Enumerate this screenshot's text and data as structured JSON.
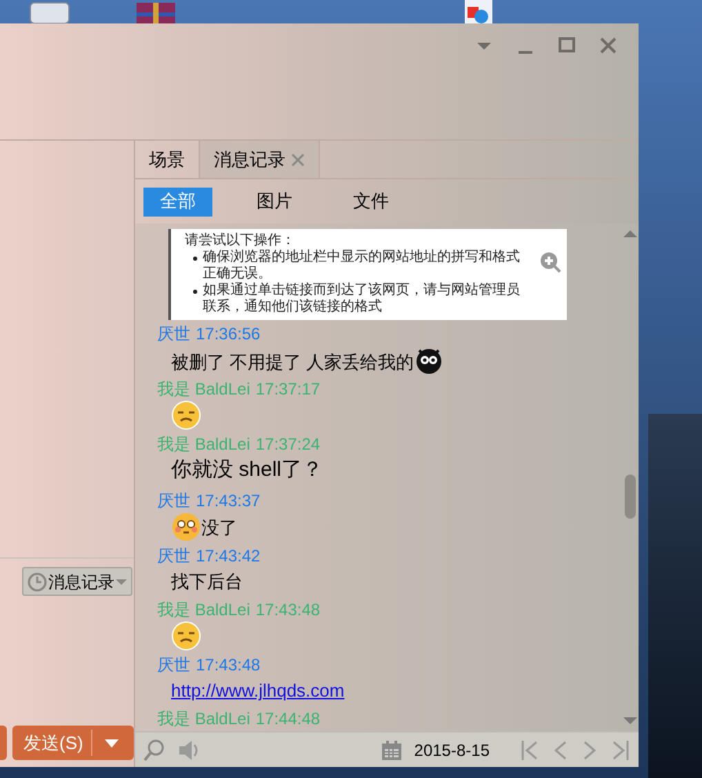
{
  "tabs": [
    {
      "label": "场景",
      "selected": false,
      "closable": false
    },
    {
      "label": "消息记录",
      "selected": true,
      "closable": true
    }
  ],
  "filters": [
    {
      "label": "全部",
      "selected": true
    },
    {
      "label": "图片",
      "selected": false
    },
    {
      "label": "文件",
      "selected": false
    }
  ],
  "messages": [
    {
      "body": [
        {
          "kind": "screenshot",
          "title": "请尝试以下操作：",
          "bullets": [
            "确保浏览器的地址栏中显示的网站地址的拼写和格式正确无误。",
            "如果通过单击链接而到达了该网页，请与网站管理员联系，通知他们该链接的格式"
          ]
        }
      ]
    },
    {
      "sender": "厌世",
      "time": "17:36:56",
      "color": "#1e78e6",
      "body": [
        {
          "kind": "text",
          "text": "被删了 不用提了 人家丢给我的"
        },
        {
          "kind": "owl"
        }
      ]
    },
    {
      "sender": "我是 BaldLei",
      "time": "17:37:17",
      "color": "#3cb371",
      "body": [
        {
          "kind": "frown"
        }
      ]
    },
    {
      "sender": "我是 BaldLei",
      "time": "17:37:24",
      "color": "#3cb371",
      "body": [
        {
          "kind": "big_text",
          "text": "你就没 shell了？"
        }
      ]
    },
    {
      "sender": "厌世",
      "time": "17:43:37",
      "color": "#1e78e6",
      "body": [
        {
          "kind": "blush"
        },
        {
          "kind": "text",
          "text": "没了"
        }
      ]
    },
    {
      "sender": "厌世",
      "time": "17:43:42",
      "color": "#1e78e6",
      "body": [
        {
          "kind": "text",
          "text": "找下后台"
        }
      ]
    },
    {
      "sender": "我是 BaldLei",
      "time": "17:43:48",
      "color": "#3cb371",
      "body": [
        {
          "kind": "frown"
        }
      ]
    },
    {
      "sender": "厌世",
      "time": "17:43:48",
      "color": "#1e78e6",
      "body": [
        {
          "kind": "link",
          "text": "http://www.jlhqds.com"
        }
      ]
    },
    {
      "sender": "我是 BaldLei",
      "time": "17:44:48",
      "color": "#3cb371"
    }
  ],
  "history_button": {
    "label": "消息记录"
  },
  "send_button": {
    "label": "发送(S)"
  },
  "toolbar": {
    "date": "2015-8-15"
  }
}
